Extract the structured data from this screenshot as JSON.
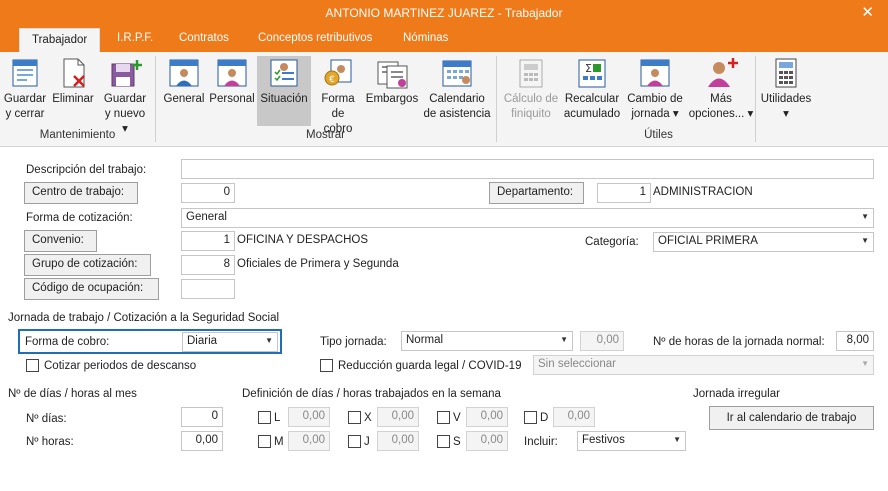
{
  "window": {
    "title": "ANTONIO MARTINEZ JUAREZ - Trabajador",
    "close_glyph": "✕"
  },
  "tabs": [
    "Trabajador",
    "I.R.P.F.",
    "Contratos",
    "Conceptos retributivos",
    "Nóminas"
  ],
  "ribbon": {
    "buttons": {
      "guardar_cerrar": [
        "Guardar",
        "y cerrar"
      ],
      "eliminar": [
        "Eliminar"
      ],
      "guardar_nuevo": [
        "Guardar",
        "y nuevo ▾"
      ],
      "general": [
        "General"
      ],
      "personal": [
        "Personal"
      ],
      "situacion": [
        "Situación"
      ],
      "forma_cobro": [
        "Forma",
        "de cobro"
      ],
      "embargos": [
        "Embargos"
      ],
      "calendario": [
        "Calendario",
        "de asistencia"
      ],
      "calculo_finiquito": [
        "Cálculo de",
        "finiquito"
      ],
      "recalcular": [
        "Recalcular",
        "acumulado"
      ],
      "cambio_jornada": [
        "Cambio de",
        "jornada ▾"
      ],
      "mas_opciones": [
        "Más",
        "opciones... ▾"
      ],
      "utilidades": [
        "Utilidades",
        "▾"
      ]
    },
    "groups": {
      "mantenimiento": "Mantenimiento",
      "mostrar": "Mostrar",
      "utiles": "Útiles"
    }
  },
  "form": {
    "descripcion_label": "Descripción del trabajo:",
    "descripcion_value": "",
    "centro_button": "Centro de trabajo:",
    "centro_value": "0",
    "departamento_button": "Departamento:",
    "departamento_value": "1",
    "departamento_name": "ADMINISTRACION",
    "forma_cotizacion_label": "Forma de cotización:",
    "forma_cotizacion_value": "General",
    "convenio_button": "Convenio:",
    "convenio_value": "1",
    "convenio_name": "OFICINA Y DESPACHOS",
    "categoria_label": "Categoría:",
    "categoria_value": "OFICIAL PRIMERA",
    "grupo_button": "Grupo de cotización:",
    "grupo_value": "8",
    "grupo_name": "Oficiales de Primera y Segunda",
    "codigo_button": "Código de ocupación:",
    "codigo_value": "",
    "jornada_section": "Jornada de trabajo / Cotización a la Seguridad Social",
    "forma_cobro_label": "Forma de cobro:",
    "forma_cobro_value": "Diaria",
    "tipo_jornada_label": "Tipo jornada:",
    "tipo_jornada_value": "Normal",
    "tipo_jornada_pct": "0,00",
    "horas_jornada_label": "Nº de horas de la jornada normal:",
    "horas_jornada_value": "8,00",
    "cotizar_descanso_label": "Cotizar periodos de descanso",
    "reduccion_label": "Reducción guarda legal / COVID-19",
    "reduccion_placeholder": "Sin seleccionar",
    "dias_horas_mes_section": "Nº de días / horas al mes",
    "dias_label": "Nº días:",
    "dias_value": "0",
    "horas_label": "Nº horas:",
    "horas_value": "0,00",
    "definicion_section": "Definición de días / horas trabajados en la semana",
    "days": [
      {
        "letter": "L",
        "value": "0,00"
      },
      {
        "letter": "X",
        "value": "0,00"
      },
      {
        "letter": "V",
        "value": "0,00"
      },
      {
        "letter": "D",
        "value": "0,00"
      },
      {
        "letter": "M",
        "value": "0,00"
      },
      {
        "letter": "J",
        "value": "0,00"
      },
      {
        "letter": "S",
        "value": "0,00"
      }
    ],
    "incluir_label": "Incluir:",
    "incluir_value": "Festivos",
    "jornada_irregular_section": "Jornada irregular",
    "calendario_button": "Ir al calendario de trabajo"
  },
  "colors": {
    "accent": "#ee7a1a",
    "focus": "#1e6fb4"
  }
}
